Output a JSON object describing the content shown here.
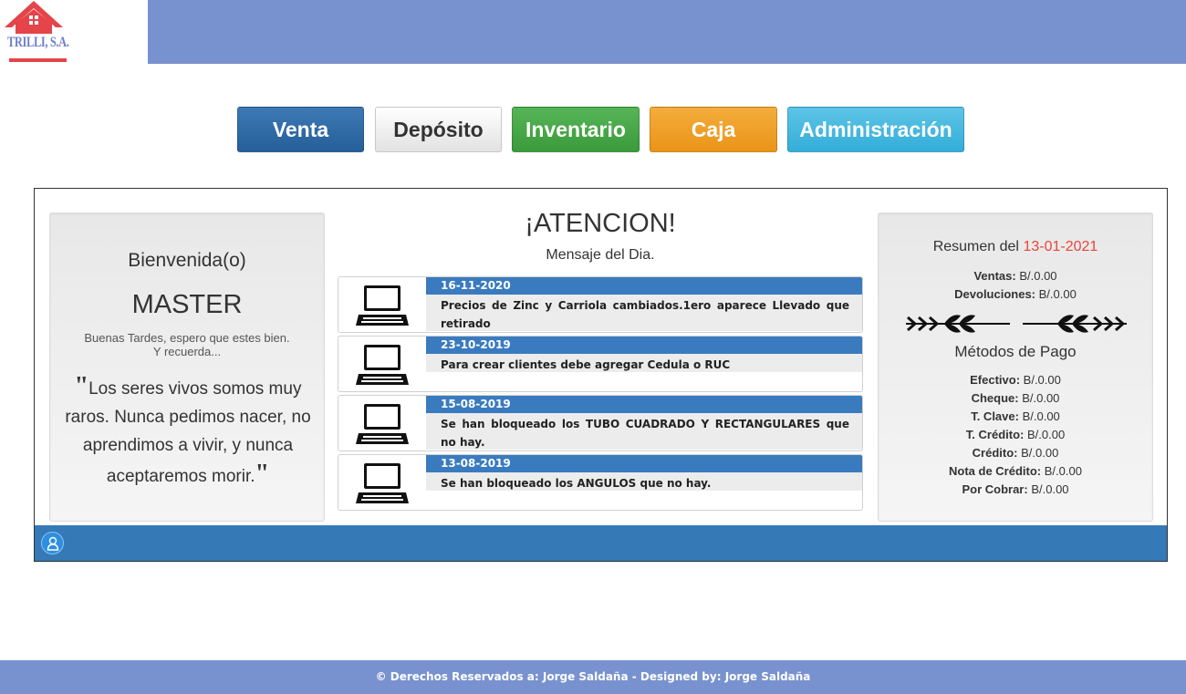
{
  "brand": {
    "logo_text": "TRILLI, S.A.",
    "color": "#6f7fc9",
    "roof_color": "#e4444a"
  },
  "header": {
    "band_color": "#7892cf"
  },
  "menu": [
    {
      "label": "Venta",
      "color": "#2f6ba8"
    },
    {
      "label": "Depósito",
      "color": "#f0f0f0"
    },
    {
      "label": "Inventario",
      "color": "#44a744"
    },
    {
      "label": "Caja",
      "color": "#f0a02a"
    },
    {
      "label": "Administración",
      "color": "#45b8df"
    }
  ],
  "welcome": {
    "title": "Bienvenida(o)",
    "user": "MASTER",
    "greeting_1": "Buenas Tardes, espero que estes bien.",
    "greeting_2": "Y recuerda...",
    "quote": "Los seres vivos somos muy raros. Nunca pedimos nacer, no aprendimos a vivir, y nunca aceptaremos morir."
  },
  "notice": {
    "title": "¡ATENCION!",
    "subtitle": "Mensaje del Dia.",
    "messages": [
      {
        "date": "16-11-2020",
        "text": "Precios de Zinc y Carriola cambiados.1ero aparece Llevado que retirado",
        "icon": "laptop-icon"
      },
      {
        "date": "23-10-2019",
        "text": "Para crear clientes debe agregar Cedula o RUC",
        "icon": "laptop-icon"
      },
      {
        "date": "15-08-2019",
        "text": "Se han bloqueado los TUBO CUADRADO Y RECTANGULARES que no hay.",
        "icon": "laptop-icon"
      },
      {
        "date": "13-08-2019",
        "text": "Se han bloqueado los ANGULOS que no hay.",
        "icon": "laptop-icon"
      }
    ]
  },
  "summary": {
    "title": "Resumen del",
    "date": "13-01-2021",
    "ventas_label": "Ventas:",
    "ventas_value": "B/.0.00",
    "devoluciones_label": "Devoluciones:",
    "devoluciones_value": "B/.0.00",
    "payment_title": "Métodos de Pago",
    "methods": [
      {
        "label": "Efectivo:",
        "value": "B/.0.00"
      },
      {
        "label": "Cheque:",
        "value": "B/.0.00"
      },
      {
        "label": "T. Clave:",
        "value": "B/.0.00"
      },
      {
        "label": "T. Crédito:",
        "value": "B/.0.00"
      },
      {
        "label": "Crédito:",
        "value": "B/.0.00"
      },
      {
        "label": "Nota de Crédito:",
        "value": "B/.0.00"
      },
      {
        "label": "Por Cobrar:",
        "value": "B/.0.00"
      }
    ]
  },
  "status_bar": {
    "icon": "user-icon",
    "color": "#3579b6"
  },
  "footer": {
    "text": "© Derechos Reservados a: Jorge Saldaña - Designed by: Jorge Saldaña"
  }
}
